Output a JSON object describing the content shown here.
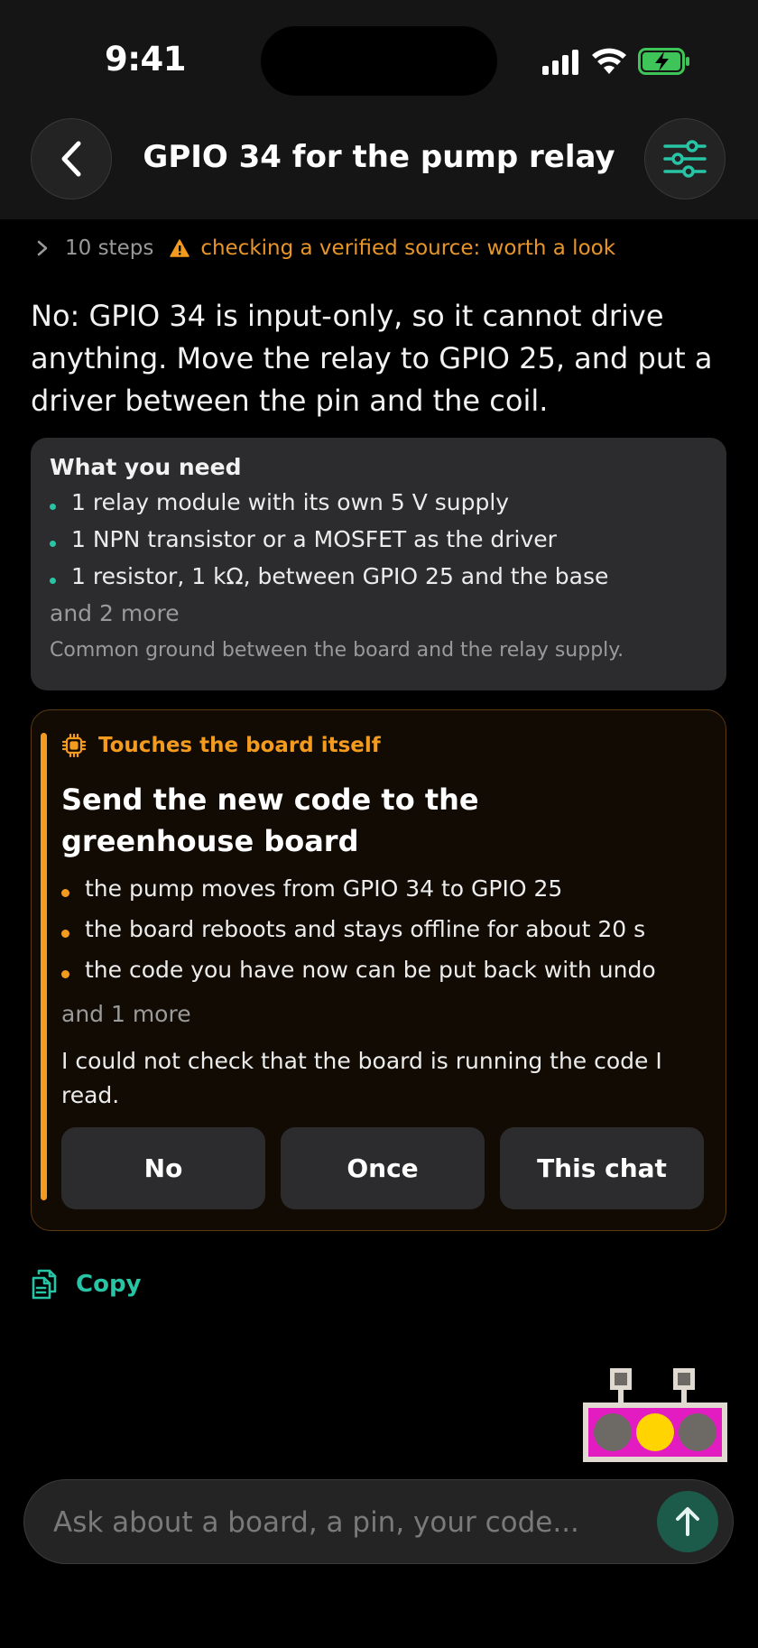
{
  "status_bar": {
    "time": "9:41"
  },
  "header": {
    "title": "GPIO 34 for the pump relay"
  },
  "reasoning": {
    "steps_label": "10 steps",
    "warning": "checking a verified source: worth a look"
  },
  "answer": "No: GPIO 34 is input-only, so it cannot drive anything. Move the relay to GPIO 25, and put a driver between the pin and the coil.",
  "needs": {
    "title": "What you need",
    "items": [
      "1 relay module with its own 5 V supply",
      "1 NPN transistor or a MOSFET as the driver",
      "1 resistor, 1 kΩ, between GPIO 25 and the base"
    ],
    "more": "and 2 more",
    "note": "Common ground between the board and the relay supply."
  },
  "action": {
    "tag": "Touches the board itself",
    "title": "Send the new code to the greenhouse board",
    "effects": [
      "the pump moves from GPIO 34 to GPIO 25",
      "the board reboots and stays offline for about 20 s",
      "the code you have now can be put back with undo"
    ],
    "more": "and 1 more",
    "note": "I could not check that the board is running the code I read.",
    "buttons": {
      "no": "No",
      "once": "Once",
      "this_chat": "This chat"
    }
  },
  "copy_label": "Copy",
  "composer": {
    "placeholder": "Ask about a board, a pin, your code..."
  },
  "colors": {
    "accent": "#27c4a6",
    "warning": "#f39b1e",
    "card": "#2c2c2e",
    "mascot_body": "#e21cc0",
    "mascot_eye": "#ffd400"
  }
}
